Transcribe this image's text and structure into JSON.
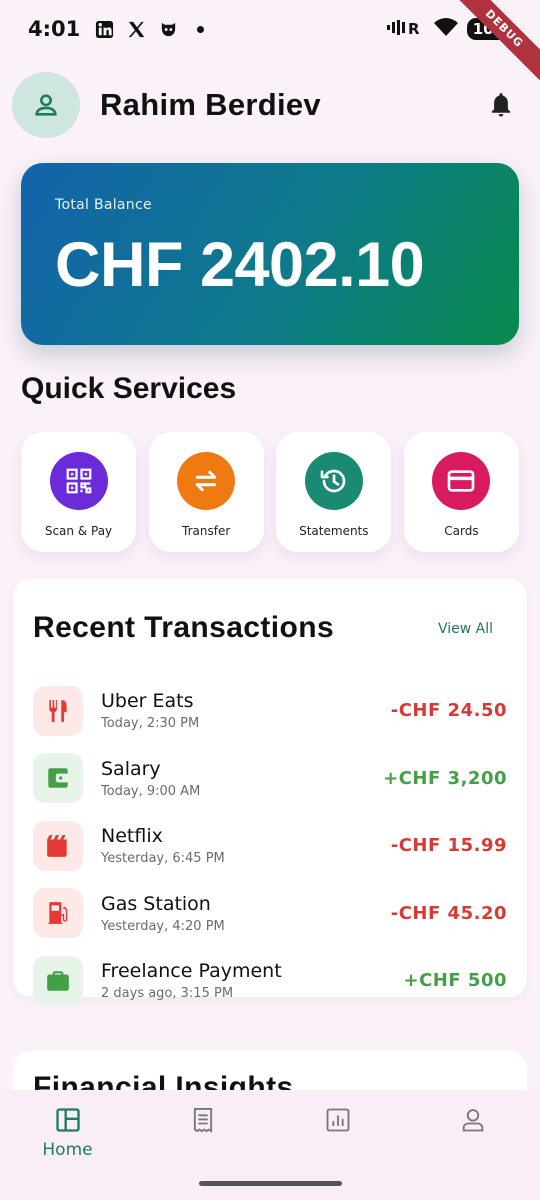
{
  "status_bar": {
    "time": "4:01",
    "left_icons": [
      "linkedin-icon",
      "x-icon",
      "app-icon",
      "dot-icon"
    ],
    "right_icons": [
      "vibrate-icon",
      "wifi-icon"
    ],
    "battery": "100",
    "debug_label": "DEBUG"
  },
  "header": {
    "user_name": "Rahim Berdiev"
  },
  "balance": {
    "label": "Total Balance",
    "amount": "CHF 2402.10"
  },
  "quick_services": {
    "title": "Quick Services",
    "items": [
      {
        "label": "Scan & Pay",
        "icon": "qr-code-icon",
        "color": "#6c2bd9"
      },
      {
        "label": "Transfer",
        "icon": "swap-arrows-icon",
        "color": "#f07a12"
      },
      {
        "label": "Statements",
        "icon": "history-icon",
        "color": "#1a8a72"
      },
      {
        "label": "Cards",
        "icon": "credit-card-icon",
        "color": "#d81b60"
      }
    ]
  },
  "transactions": {
    "title": "Recent Transactions",
    "view_all": "View All",
    "items": [
      {
        "name": "Uber Eats",
        "time": "Today, 2:30 PM",
        "amount": "-CHF 24.50",
        "icon": "restaurant-icon",
        "color": "#e53935"
      },
      {
        "name": "Salary",
        "time": "Today, 9:00 AM",
        "amount": "+CHF 3,200",
        "icon": "wallet-icon",
        "color": "#43a047"
      },
      {
        "name": "Netflix",
        "time": "Yesterday, 6:45 PM",
        "amount": "-CHF 15.99",
        "icon": "movie-icon",
        "color": "#e53935"
      },
      {
        "name": "Gas Station",
        "time": "Yesterday, 4:20 PM",
        "amount": "-CHF 45.20",
        "icon": "gas-pump-icon",
        "color": "#e53935"
      },
      {
        "name": "Freelance Payment",
        "time": "2 days ago, 3:15 PM",
        "amount": "+CHF 500",
        "icon": "briefcase-icon",
        "color": "#43a047"
      }
    ]
  },
  "insights": {
    "title": "Financial Insights"
  },
  "bottom_nav": {
    "items": [
      {
        "label": "Home",
        "icon": "dashboard-icon",
        "active": true
      },
      {
        "label": "",
        "icon": "receipt-icon",
        "active": false
      },
      {
        "label": "",
        "icon": "analytics-icon",
        "active": false
      },
      {
        "label": "",
        "icon": "profile-icon",
        "active": false
      }
    ]
  },
  "colors": {
    "accent": "#1e7d5e",
    "negative": "#d63a35",
    "positive": "#43a047"
  }
}
